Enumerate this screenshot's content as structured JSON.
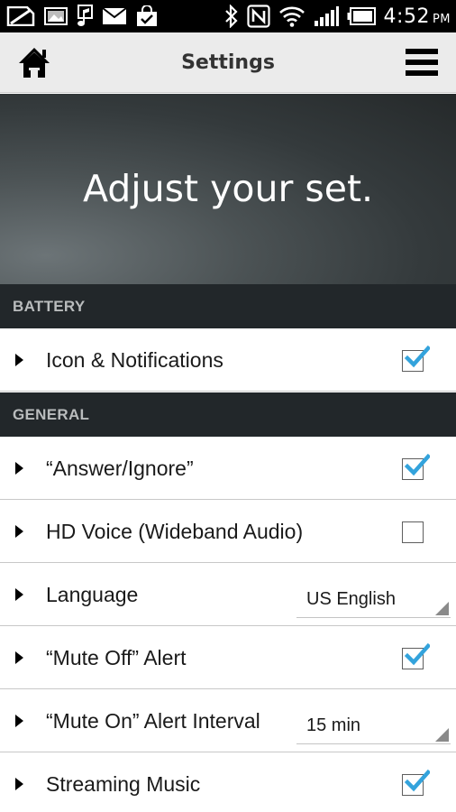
{
  "status_bar": {
    "time": "4:52",
    "ampm": "PM",
    "left_icons": [
      "no-sim-icon",
      "photo-icon",
      "music-icon",
      "mail-icon",
      "shopping-bag-icon"
    ],
    "right_icons": [
      "bluetooth-icon",
      "nfc-icon",
      "wifi-icon",
      "signal-icon",
      "battery-icon"
    ]
  },
  "app_bar": {
    "title": "Settings",
    "home_icon": "home-icon",
    "menu_icon": "hamburger-menu-icon"
  },
  "hero": {
    "tagline": "Adjust your set."
  },
  "sections": [
    {
      "header": "BATTERY",
      "items": [
        {
          "label": "Icon & Notifications",
          "control": "checkbox",
          "checked": true
        }
      ]
    },
    {
      "header": "GENERAL",
      "items": [
        {
          "label": "“Answer/Ignore”",
          "control": "checkbox",
          "checked": true
        },
        {
          "label": "HD Voice (Wideband Audio)",
          "control": "checkbox",
          "checked": false
        },
        {
          "label": "Language",
          "control": "select",
          "value": "US English"
        },
        {
          "label": "“Mute Off” Alert",
          "control": "checkbox",
          "checked": true
        },
        {
          "label": "“Mute On” Alert Interval",
          "control": "select",
          "value": "15 min"
        },
        {
          "label": "Streaming Music",
          "control": "checkbox",
          "checked": true
        }
      ]
    }
  ],
  "colors": {
    "status_bar_bg": "#000000",
    "app_bar_bg": "#ebebeb",
    "section_header_bg": "#22272a",
    "section_header_text": "#b9bcbd",
    "checkmark": "#33a3dc",
    "row_bg": "#ffffff"
  }
}
